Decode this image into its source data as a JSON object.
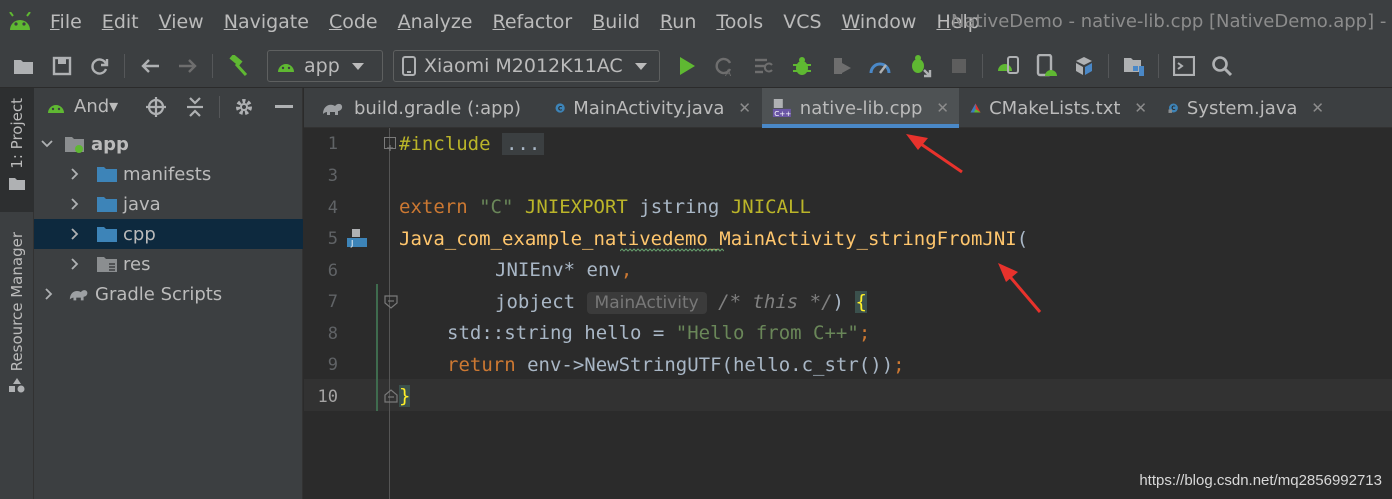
{
  "menubar": {
    "items": [
      {
        "label": "File",
        "key": "File"
      },
      {
        "label": "Edit",
        "key": "Edit"
      },
      {
        "label": "View",
        "key": "View"
      },
      {
        "label": "Navigate",
        "key": "Navigate"
      },
      {
        "label": "Code",
        "key": "Code"
      },
      {
        "label": "Analyze",
        "key": "Analyze"
      },
      {
        "label": "Refactor",
        "key": "Refactor"
      },
      {
        "label": "Build",
        "key": "Build"
      },
      {
        "label": "Run",
        "key": "Run"
      },
      {
        "label": "Tools",
        "key": "Tools"
      },
      {
        "label": "VCS",
        "key": "VCS"
      },
      {
        "label": "Window",
        "key": "Window"
      },
      {
        "label": "Help",
        "key": "Help"
      }
    ],
    "window_title": "NativeDemo - native-lib.cpp [NativeDemo.app] - Android Studio"
  },
  "toolbar": {
    "config_combo": "app",
    "device_combo": "Xiaomi M2012K11AC",
    "icons": [
      "open-folder-icon",
      "save-icon",
      "sync-icon",
      "back-arrow-icon",
      "forward-arrow-icon",
      "make-hammer-icon",
      "run-icon",
      "apply-changes-icon",
      "apply-code-changes-icon",
      "debug-icon",
      "profile-icon",
      "profiler-gauge-icon",
      "attach-debugger-icon",
      "stop-icon",
      "device-manager-icon",
      "avd-manager-icon",
      "sdk-manager-icon",
      "project-structure-icon",
      "terminal-icon",
      "search-icon"
    ]
  },
  "side_strip": {
    "project_tab": "1: Project",
    "resource_tab": "Resource Manager"
  },
  "project_panel": {
    "view_mode": "And▾",
    "tree": [
      {
        "label": "app",
        "level": 0,
        "expanded": true,
        "icon": "module-icon"
      },
      {
        "label": "manifests",
        "level": 1,
        "expanded": false,
        "icon": "folder-icon"
      },
      {
        "label": "java",
        "level": 1,
        "expanded": false,
        "icon": "folder-icon"
      },
      {
        "label": "cpp",
        "level": 1,
        "expanded": false,
        "icon": "folder-icon",
        "selected": true
      },
      {
        "label": "res",
        "level": 1,
        "expanded": false,
        "icon": "res-folder-icon"
      },
      {
        "label": "Gradle Scripts",
        "level": 0,
        "expanded": false,
        "icon": "gradle-icon"
      }
    ]
  },
  "tabs": [
    {
      "label": "build.gradle (:app)",
      "icon": "gradle-icon"
    },
    {
      "label": "MainActivity.java",
      "icon": "class-icon"
    },
    {
      "label": "native-lib.cpp",
      "icon": "cpp-file-icon",
      "active": true
    },
    {
      "label": "CMakeLists.txt",
      "icon": "cmake-icon"
    },
    {
      "label": "System.java",
      "icon": "class-icon"
    }
  ],
  "editor": {
    "line_numbers": [
      "1",
      "3",
      "4",
      "5",
      "6",
      "7",
      "8",
      "9",
      "10"
    ],
    "current_line": "10",
    "lines": {
      "l1_kw": "#include",
      "l1_fold": "...",
      "l4_extern": "extern",
      "l4_str": "\"C\"",
      "l4_jniexport": "JNIEXPORT",
      "l4_type": "jstring",
      "l4_jnicall": "JNICALL",
      "l5_fn": "Java_com_example_nativedemo_MainActivity_stringFromJNI",
      "l5_paren": "(",
      "l6_type": "JNIEnv* env",
      "l6_comma": ",",
      "l7_type": "jobject",
      "l7_hint": "MainActivity",
      "l7_comment": "/* this */",
      "l7_paren": ")",
      "l7_brace": "{",
      "l8_type": "std::string hello = ",
      "l8_str": "\"Hello from C++\"",
      "l8_semi": ";",
      "l9_kw": "return",
      "l9_rest": " env->NewStringUTF(hello.c_str())",
      "l9_semi": ";",
      "l10_brace": "}"
    }
  },
  "watermark": "https://blog.csdn.net/mq2856992713",
  "colors": {
    "accent": "#4a88c7",
    "annotation_arrow": "#e8322c",
    "android_green": "#5fb832"
  }
}
